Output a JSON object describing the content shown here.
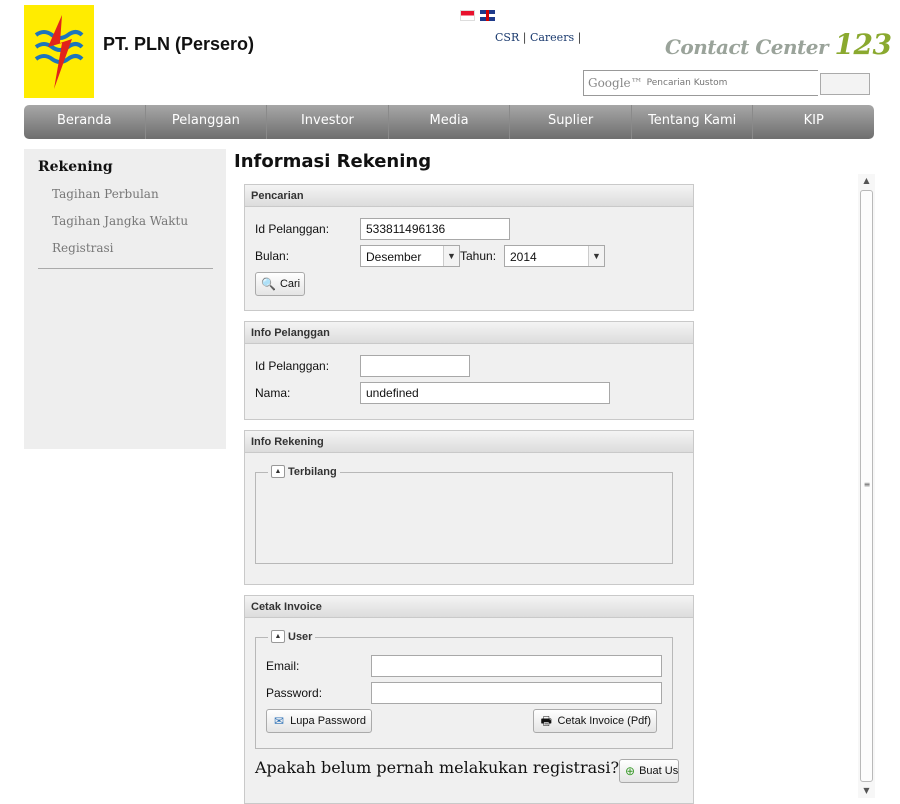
{
  "header": {
    "company_name": "PT. PLN (Persero)",
    "links": {
      "csr": "CSR",
      "careers": "Careers"
    },
    "contact_text": "Contact Center",
    "contact_number": "123",
    "search": {
      "brand": "Google™",
      "placeholder": "Pencarian Kustom"
    }
  },
  "nav": {
    "items": [
      "Beranda",
      "Pelanggan",
      "Investor",
      "Media",
      "Suplier",
      "Tentang Kami",
      "KIP"
    ]
  },
  "sidebar": {
    "title": "Rekening",
    "items": [
      "Tagihan Perbulan",
      "Tagihan Jangka Waktu",
      "Registrasi"
    ]
  },
  "page_title": "Informasi Rekening",
  "pencarian": {
    "title": "Pencarian",
    "id_label": "Id Pelanggan:",
    "id_value": "533811496136",
    "bulan_label": "Bulan:",
    "bulan_value": "Desember",
    "tahun_label": "Tahun:",
    "tahun_value": "2014",
    "cari_label": "Cari"
  },
  "info_pelanggan": {
    "title": "Info Pelanggan",
    "id_label": "Id Pelanggan:",
    "id_value": "",
    "nama_label": "Nama:",
    "nama_value": "undefined"
  },
  "info_rekening": {
    "title": "Info Rekening",
    "terbilang_legend": "Terbilang"
  },
  "cetak_invoice": {
    "title": "Cetak Invoice",
    "user_legend": "User",
    "email_label": "Email:",
    "password_label": "Password:",
    "lupa_password_label": "Lupa Password",
    "cetak_label": "Cetak Invoice (Pdf)",
    "register_prompt": "Apakah belum pernah melakukan registrasi?",
    "buat_label": "Buat Us"
  },
  "colors": {
    "logo_yellow": "#ffec00",
    "nav_gray": "#8a8a8a",
    "contact_green": "#8aa92f"
  }
}
